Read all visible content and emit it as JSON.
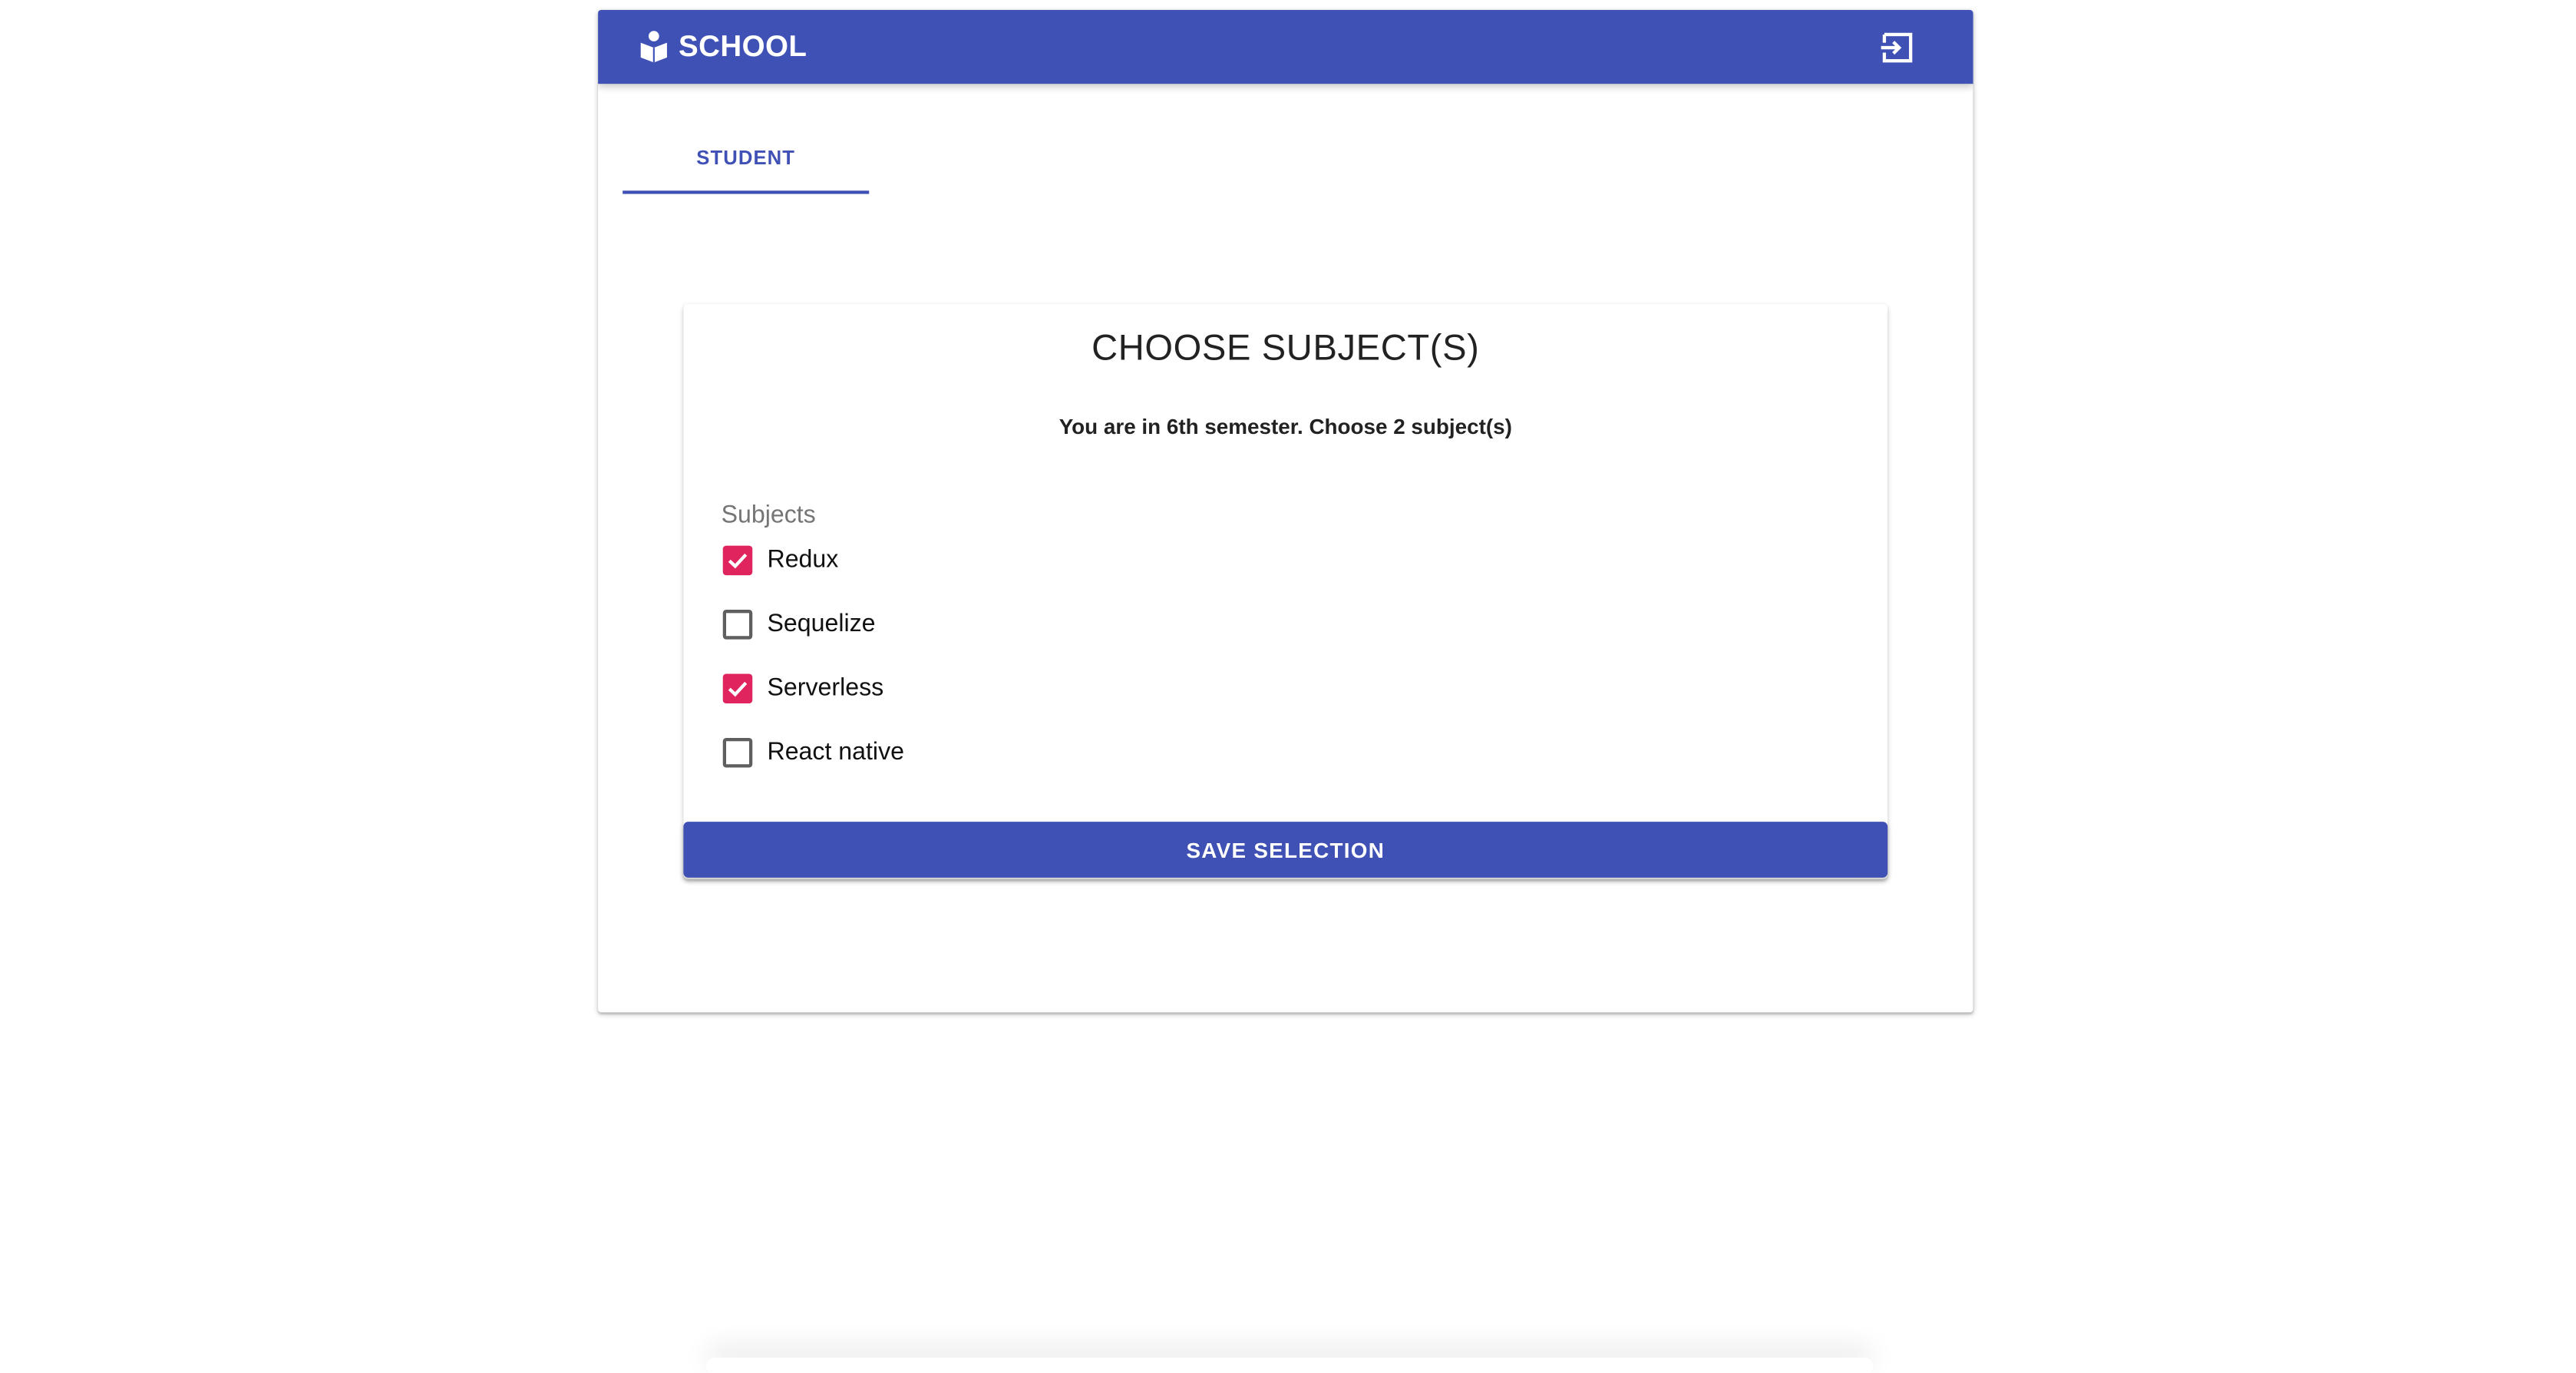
{
  "header": {
    "brand_icon": "school-building-icon",
    "title": "SCHOOL",
    "logout_icon": "exit-to-app-icon"
  },
  "tabs": [
    {
      "label": "STUDENT",
      "selected": true
    }
  ],
  "form": {
    "title": "CHOOSE SUBJECT(S)",
    "subtitle": "You are in 6th semester. Choose 2 subject(s)",
    "group_label": "Subjects",
    "options": [
      {
        "label": "Redux",
        "checked": true
      },
      {
        "label": "Sequelize",
        "checked": false
      },
      {
        "label": "Serverless",
        "checked": true
      },
      {
        "label": "React native",
        "checked": false
      }
    ],
    "save_label": "SAVE SELECTION"
  },
  "colors": {
    "primary": "#3f51b5",
    "checkbox_checked": "#e0245e",
    "checkbox_unchecked_border": "#5f5f5f",
    "group_label": "#757575"
  }
}
